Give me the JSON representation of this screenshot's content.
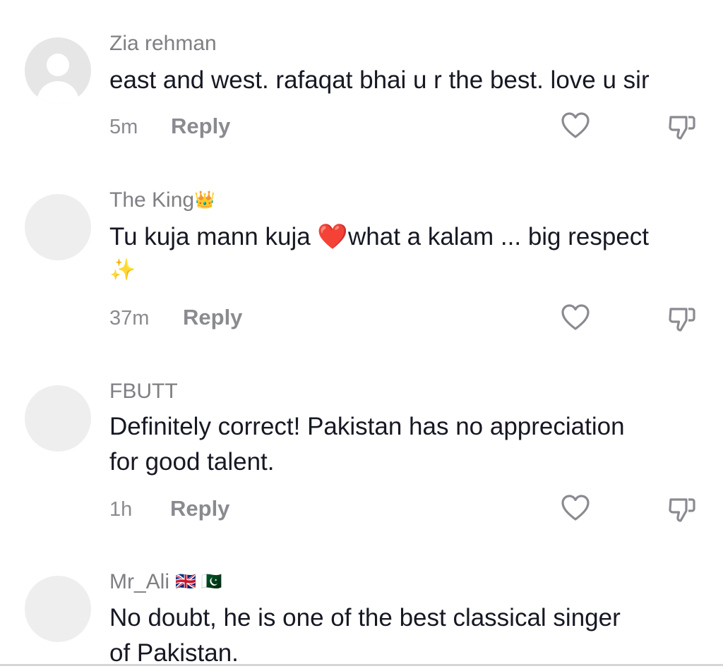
{
  "comments": [
    {
      "username": "Zia rehman",
      "username_deco": "",
      "text_lines": [
        "east and west. rafaqat bhai u r the best. love u sir"
      ],
      "time": "5m",
      "reply_label": "Reply",
      "avatar": "default-avatar"
    },
    {
      "username": "The King",
      "username_deco": "👑",
      "text_lines": [
        "Tu kuja mann kuja ❤️what a kalam ... big respect",
        "✨"
      ],
      "time": "37m",
      "reply_label": "Reply",
      "avatar": "blank"
    },
    {
      "username": "FBUTT",
      "username_deco": "",
      "text_lines": [
        "Definitely correct! Pakistan has no appreciation",
        "for good talent."
      ],
      "time": "1h",
      "reply_label": "Reply",
      "avatar": "blank"
    },
    {
      "username": "Mr_Ali",
      "username_deco": "🇬🇧 🇵🇰",
      "text_lines": [
        "No doubt, he is one of the best classical singer",
        "of Pakistan."
      ],
      "time": "",
      "reply_label": "",
      "avatar": "blank"
    }
  ],
  "icons": {
    "like": "heart-outline-icon",
    "dislike": "thumbs-down-icon"
  },
  "colors": {
    "text": "#161823",
    "muted": "#8a8b91",
    "avatar_bg": "#eeeeee"
  }
}
